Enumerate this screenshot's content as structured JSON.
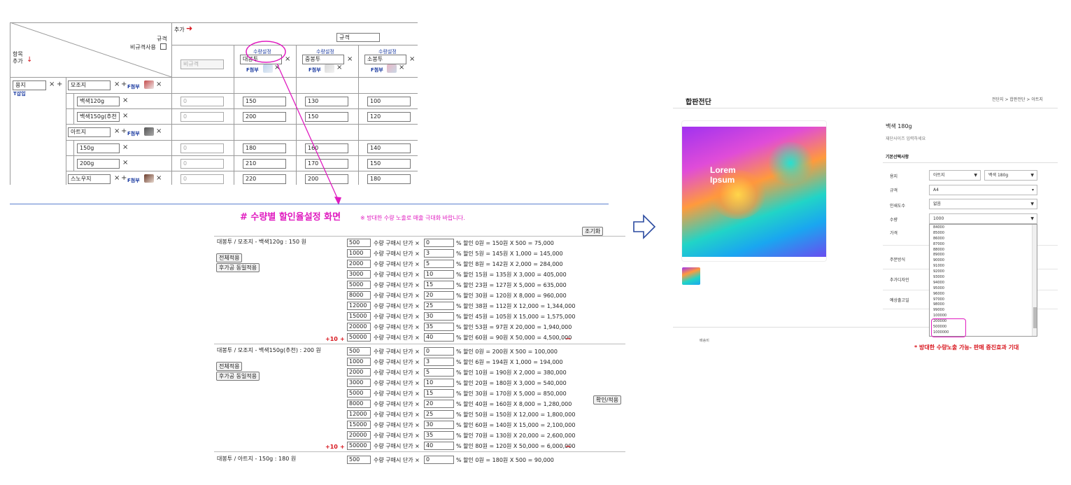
{
  "admin": {
    "header": {
      "add_col": "추가",
      "spec": "규격",
      "nonspec_use": "비규격사용",
      "item": "항목",
      "add_row": "추가",
      "spec_input": "규격",
      "nonspec_placeholder": "비규격"
    },
    "columns": [
      {
        "qty_setting": "수량설정",
        "name": "대봉투",
        "attach": "F첨부"
      },
      {
        "qty_setting": "수량설정",
        "name": "중봉투",
        "attach": "F첨부"
      },
      {
        "qty_setting": "수량설정",
        "name": "소봉투",
        "attach": "F첨부"
      }
    ],
    "paper": {
      "value": "용지",
      "insert": "T삽입"
    },
    "groups": [
      {
        "name": "모조지",
        "attach": "F첨부",
        "rows": [
          {
            "name": "백색120g",
            "vals": [
              "0",
              "150",
              "130",
              "100"
            ]
          },
          {
            "name": "백색150g(추천",
            "vals": [
              "0",
              "200",
              "150",
              "120"
            ]
          }
        ]
      },
      {
        "name": "아트지",
        "attach": "F첨부",
        "rows": [
          {
            "name": "150g",
            "vals": [
              "0",
              "180",
              "160",
              "140"
            ]
          },
          {
            "name": "200g",
            "vals": [
              "0",
              "210",
              "170",
              "150"
            ]
          }
        ]
      },
      {
        "name": "스노우지",
        "attach": "F첨부",
        "vals": [
          "0",
          "220",
          "200",
          "180"
        ]
      }
    ]
  },
  "discount": {
    "title": "# 수량별 할인율설정 화면",
    "note": "※ 방대한 수량 노출로 매출 극대화 바랍니다.",
    "reset": "조기화",
    "apply_all": "전체적용",
    "apply_post": "후가공 동일적용",
    "confirm": "확인/적용",
    "plus10": "+10",
    "plus": "+",
    "minus": "−",
    "unit_label": "수량 구매시 단가 ×",
    "sections": [
      {
        "title": "대봉투 / 모조지 - 백색120g : 150 원",
        "rows": [
          {
            "qty": "500",
            "pct": "0",
            "text": "% 할인 0원 = 150원 X 500 = 75,000"
          },
          {
            "qty": "1000",
            "pct": "3",
            "text": "% 할인 5원 = 145원 X 1,000 = 145,000"
          },
          {
            "qty": "2000",
            "pct": "5",
            "text": "% 할인 8원 = 142원 X 2,000 = 284,000"
          },
          {
            "qty": "3000",
            "pct": "10",
            "text": "% 할인 15원 = 135원 X 3,000 = 405,000"
          },
          {
            "qty": "5000",
            "pct": "15",
            "text": "% 할인 23원 = 127원 X 5,000 = 635,000"
          },
          {
            "qty": "8000",
            "pct": "20",
            "text": "% 할인 30원 = 120원 X 8,000 = 960,000"
          },
          {
            "qty": "12000",
            "pct": "25",
            "text": "% 할인 38원 = 112원 X 12,000 = 1,344,000"
          },
          {
            "qty": "15000",
            "pct": "30",
            "text": "% 할인 45원 = 105원 X 15,000 = 1,575,000"
          },
          {
            "qty": "20000",
            "pct": "35",
            "text": "% 할인 53원 = 97원 X 20,000 = 1,940,000"
          },
          {
            "qty": "50000",
            "pct": "40",
            "text": "% 할인 60원 = 90원 X 50,000 = 4,500,000"
          }
        ]
      },
      {
        "title": "대봉투 / 모조지 - 백색150g(추천) : 200 원",
        "rows": [
          {
            "qty": "500",
            "pct": "0",
            "text": "% 할인 0원 = 200원 X 500 = 100,000"
          },
          {
            "qty": "1000",
            "pct": "3",
            "text": "% 할인 6원 = 194원 X 1,000 = 194,000"
          },
          {
            "qty": "2000",
            "pct": "5",
            "text": "% 할인 10원 = 190원 X 2,000 = 380,000"
          },
          {
            "qty": "3000",
            "pct": "10",
            "text": "% 할인 20원 = 180원 X 3,000 = 540,000"
          },
          {
            "qty": "5000",
            "pct": "15",
            "text": "% 할인 30원 = 170원 X 5,000 = 850,000"
          },
          {
            "qty": "8000",
            "pct": "20",
            "text": "% 할인 40원 = 160원 X 8,000 = 1,280,000"
          },
          {
            "qty": "12000",
            "pct": "25",
            "text": "% 할인 50원 = 150원 X 12,000 = 1,800,000"
          },
          {
            "qty": "15000",
            "pct": "30",
            "text": "% 할인 60원 = 140원 X 15,000 = 2,100,000"
          },
          {
            "qty": "20000",
            "pct": "35",
            "text": "% 할인 70원 = 130원 X 20,000 = 2,600,000"
          },
          {
            "qty": "50000",
            "pct": "40",
            "text": "% 할인 80원 = 120원 X 50,000 = 6,000,000"
          }
        ]
      },
      {
        "title": "대봉투 / 아트지 - 150g : 180 원",
        "rows": [
          {
            "qty": "500",
            "pct": "0",
            "text": "% 할인 0원 = 180원 X 500 = 90,000"
          }
        ]
      }
    ]
  },
  "shop": {
    "title": "합판전단",
    "breadcrumb": "전단지 > 합판전단 > 아트지",
    "product": "백색 180g",
    "product_sub": "재단사이즈 입력하세요",
    "options_title": "기본선택사항",
    "hero_line1": "Lorem",
    "hero_line2": "Ipsum",
    "labels": {
      "paper": "용지",
      "spec": "규격",
      "color": "인쇄도수",
      "qty": "수량",
      "price": "가격",
      "order": "주문방식",
      "design": "추가디자인",
      "ship": "예상출고일"
    },
    "values": {
      "paper1": "아트지",
      "paper2": "백색 180g",
      "spec": "A4",
      "color": "없음",
      "qty": "1000"
    },
    "dropdown": [
      "84000",
      "85000",
      "86000",
      "87000",
      "88000",
      "89000",
      "90000",
      "91000",
      "92000",
      "93000",
      "94000",
      "95000",
      "96000",
      "97000",
      "98000",
      "99000",
      "100000",
      "200000",
      "500000",
      "1000000"
    ],
    "footer_text": "배송비",
    "note": "* 방대한 수량노출 가능- 판매 증진효과 기대"
  }
}
